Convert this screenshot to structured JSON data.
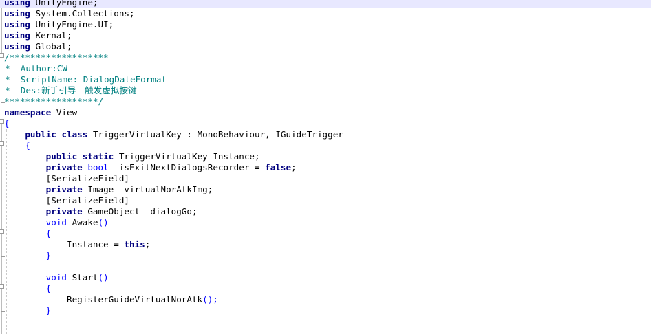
{
  "editor": {
    "lines": [
      [
        {
          "t": "using",
          "c": "kw"
        },
        {
          "t": " UnityEngine;",
          "c": ""
        }
      ],
      [
        {
          "t": "using",
          "c": "kw"
        },
        {
          "t": " System.Collections;",
          "c": ""
        }
      ],
      [
        {
          "t": "using",
          "c": "kw"
        },
        {
          "t": " UnityEngine.UI;",
          "c": ""
        }
      ],
      [
        {
          "t": "using",
          "c": "kw"
        },
        {
          "t": " Kernal;",
          "c": ""
        }
      ],
      [
        {
          "t": "using",
          "c": "kw"
        },
        {
          "t": " Global;",
          "c": ""
        }
      ],
      [
        {
          "t": "/*******************",
          "c": "cm"
        }
      ],
      [
        {
          "t": "*  Author:CW",
          "c": "cm"
        }
      ],
      [
        {
          "t": "*  ScriptName: DialogDateFormat",
          "c": "cm"
        }
      ],
      [
        {
          "t": "*  Des:",
          "c": "cm"
        },
        {
          "t": "新手引导—触发虚拟按键",
          "c": "cjk"
        }
      ],
      [
        {
          "t": "******************/",
          "c": "cm"
        }
      ],
      [
        {
          "t": "namespace",
          "c": "kw"
        },
        {
          "t": " View",
          "c": ""
        }
      ],
      [
        {
          "t": "{",
          "c": "pn"
        }
      ],
      [
        {
          "t": "    ",
          "c": ""
        },
        {
          "t": "public",
          "c": "kw"
        },
        {
          "t": " ",
          "c": ""
        },
        {
          "t": "class",
          "c": "kw"
        },
        {
          "t": " TriggerVirtualKey : MonoBehaviour, IGuideTrigger",
          "c": ""
        }
      ],
      [
        {
          "t": "    ",
          "c": ""
        },
        {
          "t": "{",
          "c": "pn"
        }
      ],
      [
        {
          "t": "        ",
          "c": ""
        },
        {
          "t": "public",
          "c": "kw"
        },
        {
          "t": " ",
          "c": ""
        },
        {
          "t": "static",
          "c": "kw"
        },
        {
          "t": " TriggerVirtualKey Instance;",
          "c": ""
        }
      ],
      [
        {
          "t": "        ",
          "c": ""
        },
        {
          "t": "private",
          "c": "kw"
        },
        {
          "t": " ",
          "c": ""
        },
        {
          "t": "bool",
          "c": "kw2"
        },
        {
          "t": " _isExitNextDialogsRecorder = ",
          "c": ""
        },
        {
          "t": "false",
          "c": "kw"
        },
        {
          "t": ";",
          "c": ""
        }
      ],
      [
        {
          "t": "        ",
          "c": ""
        },
        {
          "t": "[SerializeField]",
          "c": ""
        }
      ],
      [
        {
          "t": "        ",
          "c": ""
        },
        {
          "t": "private",
          "c": "kw"
        },
        {
          "t": " Image _virtualNorAtkImg;",
          "c": ""
        }
      ],
      [
        {
          "t": "        ",
          "c": ""
        },
        {
          "t": "[SerializeField]",
          "c": ""
        }
      ],
      [
        {
          "t": "        ",
          "c": ""
        },
        {
          "t": "private",
          "c": "kw"
        },
        {
          "t": " GameObject _dialogGo;",
          "c": ""
        }
      ],
      [
        {
          "t": "        ",
          "c": ""
        },
        {
          "t": "void",
          "c": "kw2"
        },
        {
          "t": " Awake",
          "c": ""
        },
        {
          "t": "()",
          "c": "pn"
        }
      ],
      [
        {
          "t": "        ",
          "c": ""
        },
        {
          "t": "{",
          "c": "pn"
        }
      ],
      [
        {
          "t": "            Instance = ",
          "c": ""
        },
        {
          "t": "this",
          "c": "kw"
        },
        {
          "t": ";",
          "c": ""
        }
      ],
      [
        {
          "t": "        ",
          "c": ""
        },
        {
          "t": "}",
          "c": "pn"
        }
      ],
      [
        {
          "t": "",
          "c": ""
        }
      ],
      [
        {
          "t": "        ",
          "c": ""
        },
        {
          "t": "void",
          "c": "kw2"
        },
        {
          "t": " Start",
          "c": ""
        },
        {
          "t": "()",
          "c": "pn"
        }
      ],
      [
        {
          "t": "        ",
          "c": ""
        },
        {
          "t": "{",
          "c": "pn"
        }
      ],
      [
        {
          "t": "            RegisterGuideVirtualNorAtk",
          "c": ""
        },
        {
          "t": "();",
          "c": "pn"
        }
      ],
      [
        {
          "t": "        ",
          "c": ""
        },
        {
          "t": "}",
          "c": "pn"
        }
      ],
      [
        {
          "t": "",
          "c": ""
        }
      ]
    ]
  }
}
